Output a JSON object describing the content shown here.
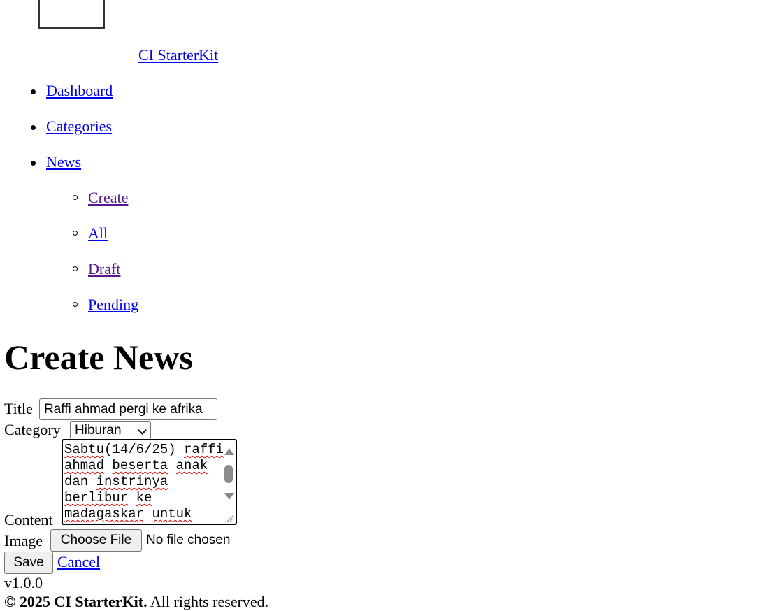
{
  "brand": {
    "name": "CI StarterKit"
  },
  "nav": {
    "items": [
      {
        "label": "Dashboard"
      },
      {
        "label": "Categories"
      },
      {
        "label": "News"
      }
    ],
    "news_sub": [
      {
        "label": "Create"
      },
      {
        "label": "All"
      },
      {
        "label": "Draft"
      },
      {
        "label": "Pending"
      }
    ]
  },
  "page": {
    "title": "Create News"
  },
  "form": {
    "title_label": "Title",
    "title_value": "Raffi ahmad pergi ke afrika",
    "category_label": "Category",
    "category_value": "Hiburan",
    "content_label": "Content",
    "content_value": "Sabtu(14/6/25) raffi ahmad beserta anak dan instrinya berlibur ke madagaskar untuk",
    "image_label": "Image",
    "file_button_label": "Choose File",
    "file_status": "No file chosen",
    "save_label": "Save",
    "cancel_label": "Cancel"
  },
  "footer": {
    "version": "v1.0.0",
    "copyright_bold": "© 2025 CI StarterKit.",
    "copyright_rest": " All rights reserved."
  }
}
